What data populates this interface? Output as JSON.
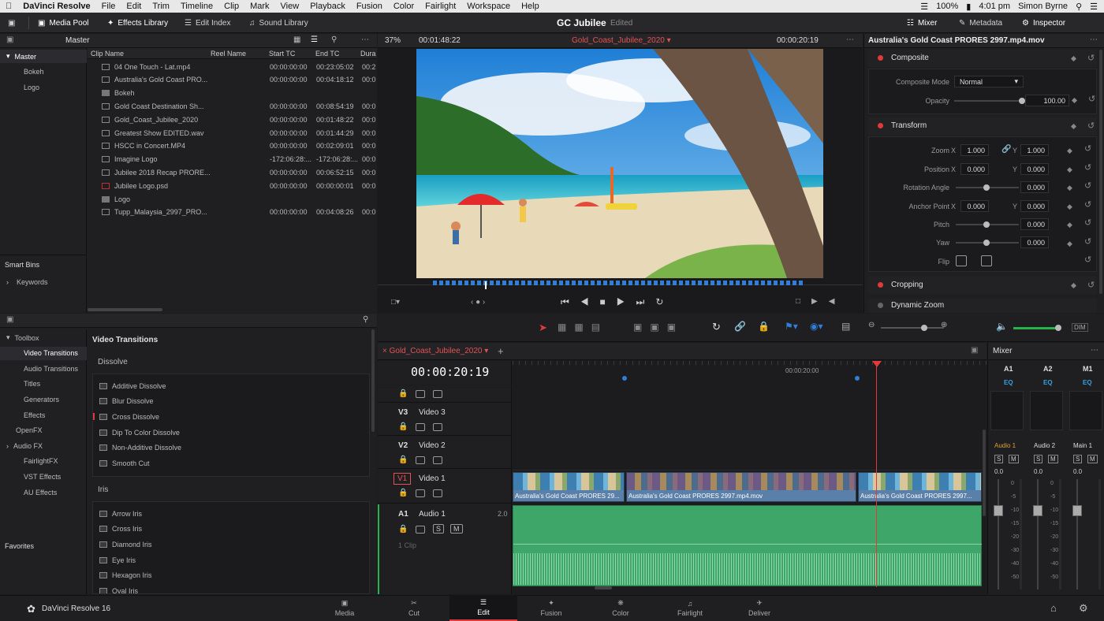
{
  "menubar": {
    "apple": "",
    "app": "DaVinci Resolve",
    "items": [
      "File",
      "Edit",
      "Trim",
      "Timeline",
      "Clip",
      "Mark",
      "View",
      "Playback",
      "Fusion",
      "Color",
      "Fairlight",
      "Workspace",
      "Help"
    ],
    "battery": "100%",
    "time": "4:01 pm",
    "user": "Simon Byrne"
  },
  "toolbar": {
    "media_pool": "Media Pool",
    "effects_library": "Effects Library",
    "edit_index": "Edit Index",
    "sound_library": "Sound Library",
    "project": "GC Jubilee",
    "status": "Edited",
    "mixer": "Mixer",
    "metadata": "Metadata",
    "inspector": "Inspector"
  },
  "mediapool": {
    "bin": "Master",
    "tree": [
      {
        "label": "Master"
      },
      {
        "label": "Bokeh"
      },
      {
        "label": "Logo"
      }
    ],
    "smart_bins": "Smart Bins",
    "keywords": "Keywords",
    "columns": [
      "Clip Name",
      "Reel Name",
      "Start TC",
      "End TC",
      "Dura"
    ],
    "clips": [
      {
        "name": "04 One Touch - Lat.mp4",
        "start": "00:00:00:00",
        "end": "00:23:05:02",
        "dur": "00:2"
      },
      {
        "name": "Australia's Gold Coast PRO...",
        "start": "00:00:00:00",
        "end": "00:04:18:12",
        "dur": "00:0"
      },
      {
        "name": "Bokeh",
        "start": "",
        "end": "",
        "dur": ""
      },
      {
        "name": "Gold Coast Destination Sh...",
        "start": "00:00:00:00",
        "end": "00:08:54:19",
        "dur": "00:0"
      },
      {
        "name": "Gold_Coast_Jubilee_2020",
        "start": "00:00:00:00",
        "end": "00:01:48:22",
        "dur": "00:0"
      },
      {
        "name": "Greatest Show EDITED.wav",
        "start": "00:00:00:00",
        "end": "00:01:44:29",
        "dur": "00:0"
      },
      {
        "name": "HSCC in Concert.MP4",
        "start": "00:00:00:00",
        "end": "00:02:09:01",
        "dur": "00:0"
      },
      {
        "name": "Imagine Logo",
        "start": "-172:06:28:...",
        "end": "-172:06:28:...",
        "dur": "00:0"
      },
      {
        "name": "Jubilee 2018 Recap PRORE...",
        "start": "00:00:00:00",
        "end": "00:06:52:15",
        "dur": "00:0"
      },
      {
        "name": "Jubilee Logo.psd",
        "start": "00:00:00:00",
        "end": "00:00:00:01",
        "dur": "00:0"
      },
      {
        "name": "Logo",
        "start": "",
        "end": "",
        "dur": ""
      },
      {
        "name": "Tupp_Malaysia_2997_PRO...",
        "start": "00:00:00:00",
        "end": "00:04:08:26",
        "dur": "00:0"
      }
    ]
  },
  "effects": {
    "tree": [
      "Toolbox",
      "Video Transitions",
      "Audio Transitions",
      "Titles",
      "Generators",
      "Effects",
      "OpenFX",
      "Audio FX",
      "FairlightFX",
      "VST Effects",
      "AU Effects"
    ],
    "favorites": "Favorites",
    "title": "Video Transitions",
    "dissolve_header": "Dissolve",
    "dissolve": [
      "Additive Dissolve",
      "Blur Dissolve",
      "Cross Dissolve",
      "Dip To Color Dissolve",
      "Non-Additive Dissolve",
      "Smooth Cut"
    ],
    "iris_header": "Iris",
    "iris": [
      "Arrow Iris",
      "Cross Iris",
      "Diamond Iris",
      "Eye Iris",
      "Hexagon Iris",
      "Oval Iris"
    ]
  },
  "viewer": {
    "zoom": "37%",
    "duration": "00:01:48:22",
    "timeline_name": "Gold_Coast_Jubilee_2020",
    "timecode": "00:00:20:19",
    "playhead_fraction": 0.14
  },
  "inspector": {
    "clip_title": "Australia's Gold Coast PRORES 2997.mp4.mov",
    "composite": "Composite",
    "composite_mode_label": "Composite Mode",
    "composite_mode": "Normal",
    "opacity_label": "Opacity",
    "opacity": "100.00",
    "transform": "Transform",
    "zoom_label": "Zoom",
    "zoom_x": "1.000",
    "zoom_y": "1.000",
    "position_label": "Position",
    "pos_x": "0.000",
    "pos_y": "0.000",
    "rotation_label": "Rotation Angle",
    "rotation": "0.000",
    "anchor_label": "Anchor Point",
    "anchor_x": "0.000",
    "anchor_y": "0.000",
    "pitch_label": "Pitch",
    "pitch": "0.000",
    "yaw_label": "Yaw",
    "yaw": "0.000",
    "flip_label": "Flip",
    "cropping": "Cropping",
    "dynamic_zoom": "Dynamic Zoom",
    "x": "X",
    "y": "Y"
  },
  "timeline": {
    "tab": "Gold_Coast_Jubilee_2020",
    "timecode": "00:00:20:19",
    "ruler_mark": "00:00:20:00",
    "tracks": [
      {
        "id": "V3",
        "name": "Video 3"
      },
      {
        "id": "V2",
        "name": "Video 2"
      },
      {
        "id": "V1",
        "name": "Video 1"
      },
      {
        "id": "A1",
        "name": "Audio 1",
        "level": "2.0",
        "clips": "1 Clip"
      }
    ],
    "clips": [
      "Australia's Gold Coast PRORES 29...",
      "Australia's Gold Coast PRORES 2997.mp4.mov",
      "Australia's Gold Coast PRORES 2997..."
    ]
  },
  "mixer": {
    "title": "Mixer",
    "channels": [
      "A1",
      "A2",
      "M1"
    ],
    "eq": "EQ",
    "strips": [
      "Audio 1",
      "Audio 2",
      "Main 1"
    ],
    "s": "S",
    "m": "M",
    "level": "0.0",
    "scale": [
      "0",
      "-5",
      "-10",
      "-15",
      "-20",
      "-30",
      "-40",
      "-50"
    ]
  },
  "pages": [
    "Media",
    "Cut",
    "Edit",
    "Fusion",
    "Color",
    "Fairlight",
    "Deliver"
  ],
  "brand": "DaVinci Resolve 16"
}
